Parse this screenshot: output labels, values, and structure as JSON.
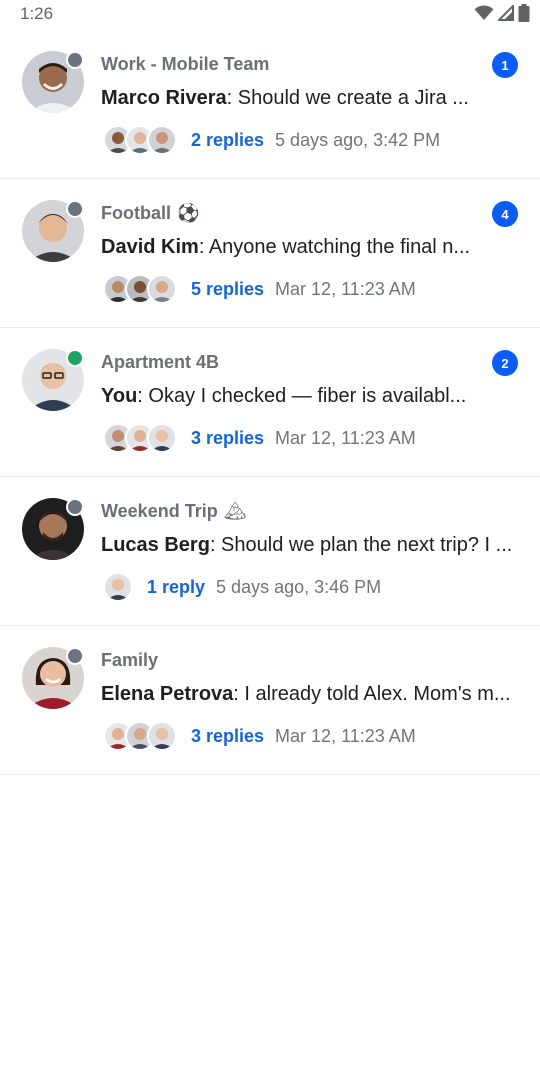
{
  "status_bar": {
    "time": "1:26",
    "icons": [
      "wifi-icon",
      "signal-icon",
      "battery-icon"
    ]
  },
  "threads": [
    {
      "group": "Work - Mobile Team",
      "group_emoji": "",
      "unread": "1",
      "presence": "#6b7280",
      "sender": "Marco Rivera",
      "message": ": Should we create a Jira ...",
      "replies": "2 replies",
      "time": "5 days ago, 3:42 PM"
    },
    {
      "group": "Football",
      "group_emoji": "⚽",
      "unread": "4",
      "presence": "#6b7280",
      "sender": "David Kim",
      "message": ": Anyone watching the final n...",
      "replies": "5 replies",
      "time": "Mar 12, 11:23 AM"
    },
    {
      "group": "Apartment 4B",
      "group_emoji": "",
      "unread": "2",
      "presence": "#1fa463",
      "sender": "You",
      "message": ": Okay I checked — fiber is availabl...",
      "replies": "3 replies",
      "time": "Mar 12, 11:23 AM"
    },
    {
      "group": "Weekend Trip",
      "group_emoji": "🏔",
      "unread": "",
      "presence": "#6b7280",
      "sender": "Lucas Berg",
      "message": ": Should we plan the next trip? I ...",
      "replies": "1 reply",
      "time": "5 days ago, 3:46 PM"
    },
    {
      "group": "Family",
      "group_emoji": "",
      "unread": "",
      "presence": "#6b7280",
      "sender": "Elena Petrova",
      "message": ": I already told Alex. Mom's m...",
      "replies": "3 replies",
      "time": "Mar 12, 11:23 AM"
    }
  ],
  "colors": {
    "accent": "#1565d8",
    "badge": "#0b5cf5",
    "offline": "#6b7280",
    "online": "#1fa463"
  }
}
